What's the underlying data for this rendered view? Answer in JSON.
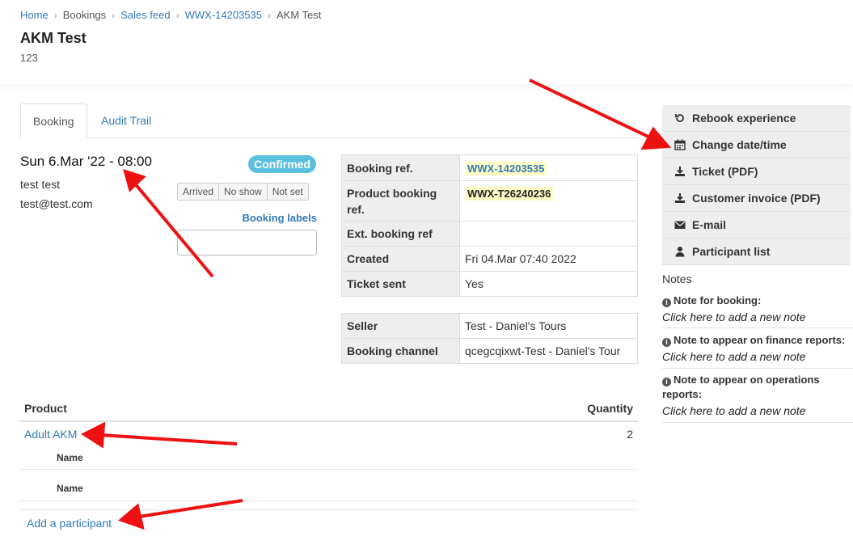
{
  "breadcrumb": {
    "home": "Home",
    "bookings": "Bookings",
    "sales_feed": "Sales feed",
    "ref": "WWX-14203535",
    "current": "AKM Test",
    "separator": "›"
  },
  "page": {
    "title": "AKM Test",
    "subtitle": "123"
  },
  "tabs": [
    {
      "label": "Booking",
      "active": true
    },
    {
      "label": "Audit Trail",
      "active": false
    }
  ],
  "booking": {
    "datetime": "Sun 6.Mar '22 - 08:00",
    "customer_name": "test test",
    "customer_email": "test@test.com",
    "status": "Confirmed",
    "status_color": "#5bc0de",
    "attendance": [
      "Arrived",
      "No show",
      "Not set"
    ],
    "labels_link": "Booking labels",
    "labels_input_value": ""
  },
  "details": [
    {
      "key": "Booking ref.",
      "value": "WWX-14203535"
    },
    {
      "key": "Product booking ref.",
      "value": "WWX-T26240236"
    },
    {
      "key": "Ext. booking ref",
      "value": ""
    },
    {
      "key": "Created",
      "value": "Fri 04.Mar 07:40 2022"
    },
    {
      "key": "Ticket sent",
      "value": "Yes"
    }
  ],
  "seller": [
    {
      "key": "Seller",
      "value": "Test - Daniel's Tours"
    },
    {
      "key": "Booking channel",
      "value": "qcegcqixwt-Test - Daniel's Tour"
    }
  ],
  "products": {
    "col_product": "Product",
    "col_quantity": "Quantity",
    "item": {
      "name": "Adult AKM",
      "quantity": "2"
    },
    "participants": [
      "Name",
      "Name"
    ],
    "add_participant": "Add a participant"
  },
  "actions": [
    {
      "label": "Rebook experience",
      "icon": "rebook-icon"
    },
    {
      "label": "Change date/time",
      "icon": "calendar-icon"
    },
    {
      "label": "Ticket (PDF)",
      "icon": "download-icon"
    },
    {
      "label": "Customer invoice (PDF)",
      "icon": "download-icon"
    },
    {
      "label": "E-mail",
      "icon": "envelope-icon"
    },
    {
      "label": "Participant list",
      "icon": "user-icon"
    }
  ],
  "notes": {
    "title": "Notes",
    "items": [
      {
        "title": "Note for booking:",
        "link": "Click here to add a new note"
      },
      {
        "title": "Note to appear on finance reports:",
        "link": "Click here to add a new note"
      },
      {
        "title": "Note to appear on operations reports:",
        "link": "Click here to add a new note"
      }
    ]
  },
  "colors": {
    "accent": "#337ab7",
    "highlight": "#fdfcc4",
    "annotation_arrow": "#ee1111"
  }
}
